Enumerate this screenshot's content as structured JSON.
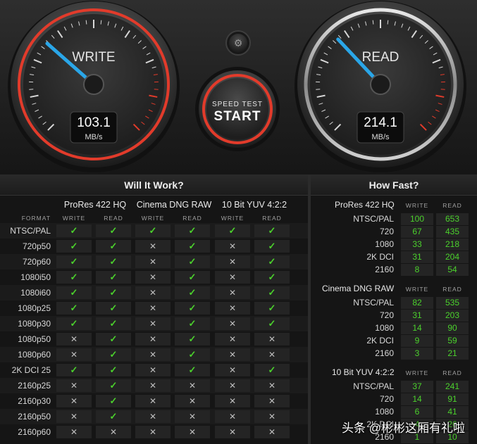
{
  "gauges": {
    "write": {
      "label": "WRITE",
      "value": "103.1",
      "unit": "MB/s",
      "needle_fraction": 0.32
    },
    "read": {
      "label": "READ",
      "value": "214.1",
      "unit": "MB/s",
      "needle_fraction": 0.34
    },
    "accent_color": "#e23b2b",
    "needle_color": "#2aa6e8"
  },
  "start_button": {
    "line1": "SPEED TEST",
    "line2": "START"
  },
  "settings_icon": "gear-icon",
  "will_it_work": {
    "title": "Will It Work?",
    "format_header": "FORMAT",
    "codecs": [
      "ProRes 422 HQ",
      "Cinema DNG RAW",
      "10 Bit YUV 4:2:2"
    ],
    "sub_labels": [
      "WRITE",
      "READ"
    ],
    "rows": [
      {
        "format": "NTSC/PAL",
        "cells": [
          1,
          1,
          1,
          1,
          1,
          1
        ]
      },
      {
        "format": "720p50",
        "cells": [
          1,
          1,
          0,
          1,
          0,
          1
        ]
      },
      {
        "format": "720p60",
        "cells": [
          1,
          1,
          0,
          1,
          0,
          1
        ]
      },
      {
        "format": "1080i50",
        "cells": [
          1,
          1,
          0,
          1,
          0,
          1
        ]
      },
      {
        "format": "1080i60",
        "cells": [
          1,
          1,
          0,
          1,
          0,
          1
        ]
      },
      {
        "format": "1080p25",
        "cells": [
          1,
          1,
          0,
          1,
          0,
          1
        ]
      },
      {
        "format": "1080p30",
        "cells": [
          1,
          1,
          0,
          1,
          0,
          1
        ]
      },
      {
        "format": "1080p50",
        "cells": [
          0,
          1,
          0,
          1,
          0,
          0
        ]
      },
      {
        "format": "1080p60",
        "cells": [
          0,
          1,
          0,
          1,
          0,
          0
        ]
      },
      {
        "format": "2K DCI 25",
        "cells": [
          1,
          1,
          0,
          1,
          0,
          1
        ]
      },
      {
        "format": "2160p25",
        "cells": [
          0,
          1,
          0,
          0,
          0,
          0
        ]
      },
      {
        "format": "2160p30",
        "cells": [
          0,
          1,
          0,
          0,
          0,
          0
        ]
      },
      {
        "format": "2160p50",
        "cells": [
          0,
          1,
          0,
          0,
          0,
          0
        ]
      },
      {
        "format": "2160p60",
        "cells": [
          0,
          0,
          0,
          0,
          0,
          0
        ]
      }
    ],
    "ok_glyph": "✓",
    "no_glyph": "✕"
  },
  "how_fast": {
    "title": "How Fast?",
    "sub_labels": [
      "WRITE",
      "READ"
    ],
    "groups": [
      {
        "name": "ProRes 422 HQ",
        "rows": [
          {
            "format": "NTSC/PAL",
            "write": "100",
            "read": "653"
          },
          {
            "format": "720",
            "write": "67",
            "read": "435"
          },
          {
            "format": "1080",
            "write": "33",
            "read": "218"
          },
          {
            "format": "2K DCI",
            "write": "31",
            "read": "204"
          },
          {
            "format": "2160",
            "write": "8",
            "read": "54"
          }
        ]
      },
      {
        "name": "Cinema DNG RAW",
        "rows": [
          {
            "format": "NTSC/PAL",
            "write": "82",
            "read": "535"
          },
          {
            "format": "720",
            "write": "31",
            "read": "203"
          },
          {
            "format": "1080",
            "write": "14",
            "read": "90"
          },
          {
            "format": "2K DCI",
            "write": "9",
            "read": "59"
          },
          {
            "format": "2160",
            "write": "3",
            "read": "21"
          }
        ]
      },
      {
        "name": "10 Bit YUV 4:2:2",
        "rows": [
          {
            "format": "NTSC/PAL",
            "write": "37",
            "read": "241"
          },
          {
            "format": "720",
            "write": "14",
            "read": "91"
          },
          {
            "format": "1080",
            "write": "6",
            "read": "41"
          },
          {
            "format": "2K DCI",
            "write": "4",
            "read": "26"
          },
          {
            "format": "2160",
            "write": "1",
            "read": "10"
          }
        ]
      }
    ]
  },
  "watermark": "头条 @彬彬这厢有礼啦"
}
